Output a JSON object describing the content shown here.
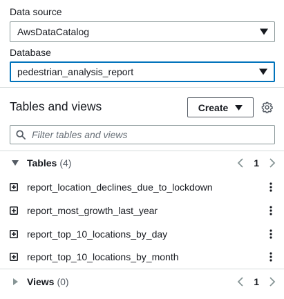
{
  "data_source": {
    "label": "Data source",
    "value": "AwsDataCatalog"
  },
  "database": {
    "label": "Database",
    "value": "pedestrian_analysis_report"
  },
  "tables_and_views": {
    "title": "Tables and views",
    "create_label": "Create",
    "filter_placeholder": "Filter tables and views"
  },
  "tables": {
    "label": "Tables",
    "count": "(4)",
    "page": "1",
    "items": [
      {
        "name": "report_location_declines_due_to_lockdown"
      },
      {
        "name": "report_most_growth_last_year"
      },
      {
        "name": "report_top_10_locations_by_day"
      },
      {
        "name": "report_top_10_locations_by_month"
      }
    ]
  },
  "views": {
    "label": "Views",
    "count": "(0)",
    "page": "1"
  },
  "icons": {
    "dropdown": "caret-down-icon",
    "settings": "gear-icon",
    "search": "search-icon",
    "expand": "caret-right-icon",
    "collapse": "caret-down-icon",
    "table": "plus-square-icon",
    "more": "vertical-ellipsis-icon",
    "prev": "chevron-left-icon",
    "next": "chevron-right-icon"
  },
  "colors": {
    "focus_border": "#0073bb",
    "text": "#16191f",
    "muted": "#879596"
  }
}
